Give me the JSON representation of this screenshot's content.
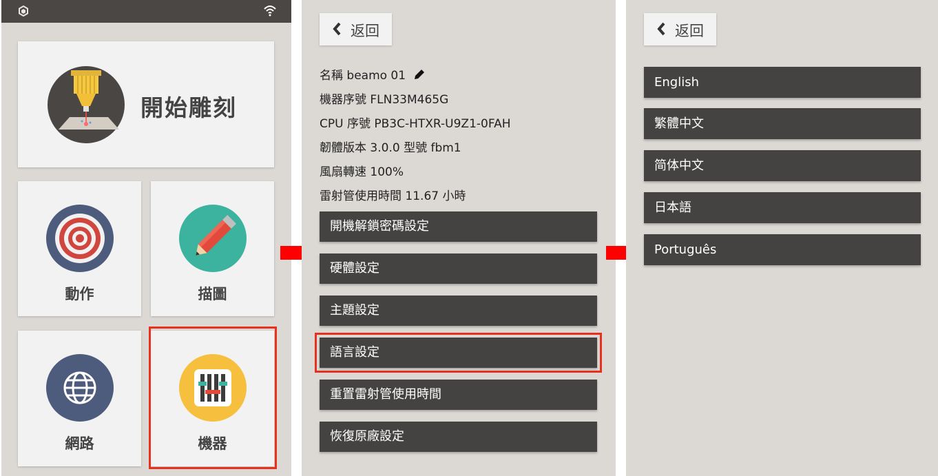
{
  "home": {
    "tiles": {
      "start": "開始雕刻",
      "move": "動作",
      "draw": "描圖",
      "network": "網路",
      "machine": "機器"
    }
  },
  "machine_info": {
    "back_label": "返回",
    "name": "名稱 beamo 01",
    "serial": "機器序號 FLN33M465G",
    "cpu_serial": "CPU 序號 PB3C-HTXR-U9Z1-0FAH",
    "firmware": "韌體版本 3.0.0 型號 fbm1",
    "fan_speed": "風扇轉速 100%",
    "laser_time": "雷射管使用時間 11.67 小時",
    "menu": [
      "開機解鎖密碼設定",
      "硬體設定",
      "主題設定",
      "語言設定",
      "重置雷射管使用時間",
      "恢復原廠設定"
    ]
  },
  "language": {
    "back_label": "返回",
    "options": [
      "English",
      "繁體中文",
      "简体中文",
      "日本語",
      "Português"
    ]
  },
  "colors": {
    "panel_bg": "#dcd9d5",
    "tile_bg": "#f2f2f2",
    "button_bg": "#444342",
    "highlight": "#e8301c",
    "arrow": "#ff0000"
  }
}
